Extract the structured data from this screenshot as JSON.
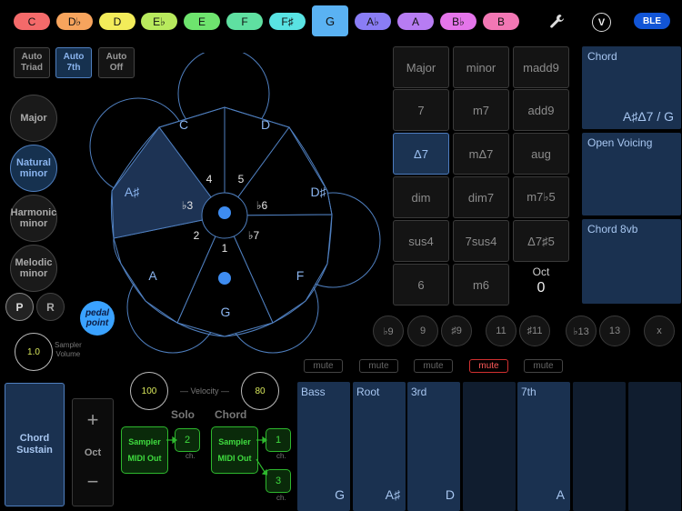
{
  "keys": [
    {
      "label": "C",
      "color": "#f46a6a"
    },
    {
      "label": "D♭",
      "color": "#f7a45d"
    },
    {
      "label": "D",
      "color": "#f3ec5a"
    },
    {
      "label": "E♭",
      "color": "#b8ea5d"
    },
    {
      "label": "E",
      "color": "#6ee46e"
    },
    {
      "label": "F",
      "color": "#5fe0a1"
    },
    {
      "label": "F♯",
      "color": "#59e3e3"
    },
    {
      "label": "G",
      "color": "#5ab2f3"
    },
    {
      "label": "A♭",
      "color": "#8a7df5"
    },
    {
      "label": "A",
      "color": "#b77cf3"
    },
    {
      "label": "B♭",
      "color": "#e475ea"
    },
    {
      "label": "B",
      "color": "#f277b4"
    }
  ],
  "selected_key": "G",
  "top_right": {
    "settings_icon": "wrench-icon",
    "v_label": "V",
    "ble_label": "BLE"
  },
  "auto": {
    "triad": "Auto\nTriad",
    "seventh": "Auto\n7th",
    "off": "Auto\nOff"
  },
  "scales": {
    "major": "Major",
    "natural": "Natural\nminor",
    "harmonic": "Harmonic\nminor",
    "melodic": "Melodic\nminor"
  },
  "pr": {
    "p": "P",
    "r": "R"
  },
  "pedal": "pedal\npoint",
  "sampler_volume": {
    "value": "1.0",
    "label": "Sampler\nVolume"
  },
  "wheel": {
    "notes": [
      "C",
      "D",
      "D♯",
      "F",
      "G",
      "A",
      "A♯"
    ],
    "degrees": [
      "4",
      "5",
      "♭6",
      "♭7",
      "1",
      "2",
      "♭3"
    ]
  },
  "qualities": [
    [
      "Major",
      "minor",
      "madd9"
    ],
    [
      "7",
      "m7",
      "add9"
    ],
    [
      "Δ7",
      "mΔ7",
      "aug"
    ],
    [
      "dim",
      "dim7",
      "m7♭5"
    ],
    [
      "sus4",
      "7sus4",
      "Δ7♯5"
    ],
    [
      "6",
      "m6"
    ]
  ],
  "selected_quality": "Δ7",
  "octave": {
    "label": "Oct",
    "value": "0"
  },
  "panels": {
    "chord_title": "Chord",
    "chord_name": "A♯Δ7 / G",
    "open_voicing": "Open Voicing",
    "chord_8vb": "Chord 8vb"
  },
  "extensions": [
    "♭9",
    "9",
    "♯9",
    "11",
    "♯11",
    "♭13",
    "13",
    "x"
  ],
  "mute_label": "mute",
  "chord_sustain": "Chord\nSustain",
  "oct_stepper": {
    "plus": "+",
    "label": "Oct",
    "minus": "−"
  },
  "velocity": {
    "left": "100",
    "right": "80",
    "label": "— Velocity —"
  },
  "solo": {
    "title": "Solo",
    "sampler": "Sampler",
    "midi": "MIDI Out",
    "ch": "2",
    "ch_label": "ch."
  },
  "chord": {
    "title": "Chord",
    "sampler": "Sampler",
    "midi": "MIDI Out",
    "ch1": "1",
    "ch2": "3",
    "ch_label": "ch."
  },
  "voices": [
    {
      "label": "Bass",
      "note": "G"
    },
    {
      "label": "Root",
      "note": "A♯"
    },
    {
      "label": "3rd",
      "note": "D"
    },
    {
      "label": "",
      "note": ""
    },
    {
      "label": "7th",
      "note": "A"
    },
    {
      "label": "",
      "note": ""
    },
    {
      "label": "",
      "note": ""
    }
  ]
}
